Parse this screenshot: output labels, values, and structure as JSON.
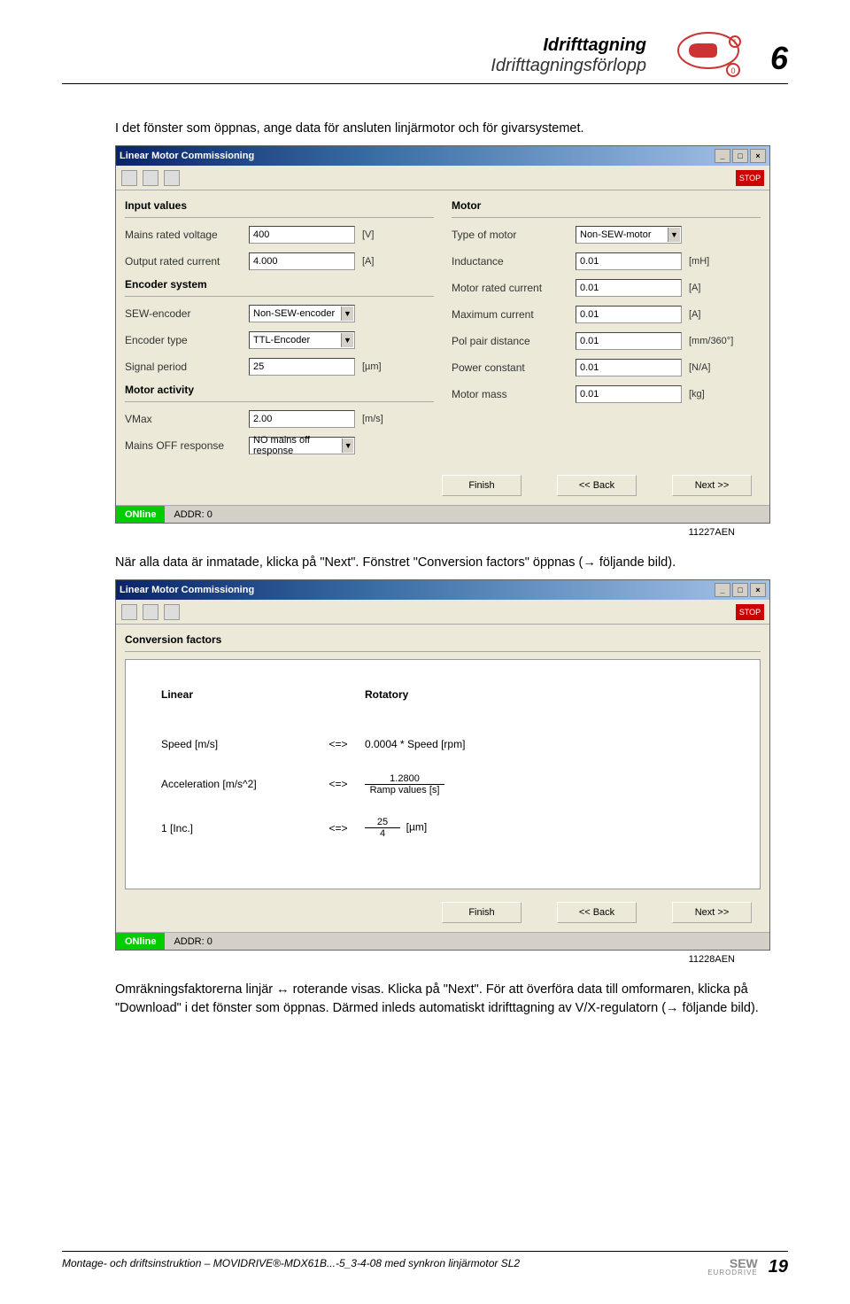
{
  "header": {
    "title1": "Idrifttagning",
    "title2": "Idrifttagningsförlopp",
    "chapter": "6"
  },
  "para1": "I det fönster som öppnas, ange data för ansluten linjärmotor och för givarsystemet.",
  "dlg1": {
    "title": "Linear Motor Commissioning",
    "toolbar_stop": "STOP",
    "sections": {
      "input_values": "Input values",
      "encoder_system": "Encoder system",
      "motor_activity": "Motor activity",
      "motor": "Motor"
    },
    "left": {
      "mains_rated_voltage": {
        "label": "Mains rated voltage",
        "value": "400",
        "unit": "[V]"
      },
      "output_rated_current": {
        "label": "Output rated current",
        "value": "4.000",
        "unit": "[A]"
      },
      "sew_encoder": {
        "label": "SEW-encoder",
        "value": "Non-SEW-encoder"
      },
      "encoder_type": {
        "label": "Encoder type",
        "value": "TTL-Encoder"
      },
      "signal_period": {
        "label": "Signal period",
        "value": "25",
        "unit": "[µm]"
      },
      "vmax": {
        "label": "VMax",
        "value": "2.00",
        "unit": "[m/s]"
      },
      "mains_off": {
        "label": "Mains OFF response",
        "value": "NO mains off response"
      }
    },
    "right": {
      "type_of_motor": {
        "label": "Type of motor",
        "value": "Non-SEW-motor"
      },
      "inductance": {
        "label": "Inductance",
        "value": "0.01",
        "unit": "[mH]"
      },
      "motor_rated_current": {
        "label": "Motor rated current",
        "value": "0.01",
        "unit": "[A]"
      },
      "maximum_current": {
        "label": "Maximum current",
        "value": "0.01",
        "unit": "[A]"
      },
      "pol_pair": {
        "label": "Pol pair distance",
        "value": "0.01",
        "unit": "[mm/360°]"
      },
      "power_constant": {
        "label": "Power constant",
        "value": "0.01",
        "unit": "[N/A]"
      },
      "motor_mass": {
        "label": "Motor mass",
        "value": "0.01",
        "unit": "[kg]"
      }
    },
    "buttons": {
      "finish": "Finish",
      "back": "<< Back",
      "next": "Next >>"
    },
    "status": {
      "online": "ONline",
      "addr": "ADDR: 0"
    },
    "caption": "11227AEN"
  },
  "para2": "När alla data är inmatade, klicka på \"Next\". Fönstret \"Conversion factors\" öppnas (→ följande bild).",
  "dlg2": {
    "title": "Linear Motor Commissioning",
    "section": "Conversion factors",
    "col_linear": "Linear",
    "col_rotatory": "Rotatory",
    "rows": {
      "speed": {
        "l": "Speed [m/s]",
        "op": "<=>",
        "r": "0.0004 * Speed [rpm]"
      },
      "accel": {
        "l": "Acceleration [m/s^2]",
        "op": "<=>",
        "frac_top": "1.2800",
        "frac_bot": "Ramp values [s]"
      },
      "inc": {
        "l": "1 [Inc.]",
        "op": "<=>",
        "frac_top": "25",
        "frac_mid_unit": "[µm]",
        "frac_bot": "4"
      }
    },
    "buttons": {
      "finish": "Finish",
      "back": "<< Back",
      "next": "Next >>"
    },
    "status": {
      "online": "ONline",
      "addr": "ADDR: 0"
    },
    "caption": "11228AEN"
  },
  "para3": "Omräkningsfaktorerna linjär ↔ roterande visas. Klicka på \"Next\". För att överföra data till omformaren, klicka på \"Download\" i det fönster som öppnas. Därmed inleds automatiskt idrifttagning av V/X-regulatorn (→ följande bild).",
  "footer": {
    "text": "Montage- och driftsinstruktion – MOVIDRIVE®-MDX61B...-5_3-4-08 med synkron linjärmotor SL2",
    "page": "19",
    "logo1": "SEW",
    "logo2": "EURODRIVE"
  }
}
